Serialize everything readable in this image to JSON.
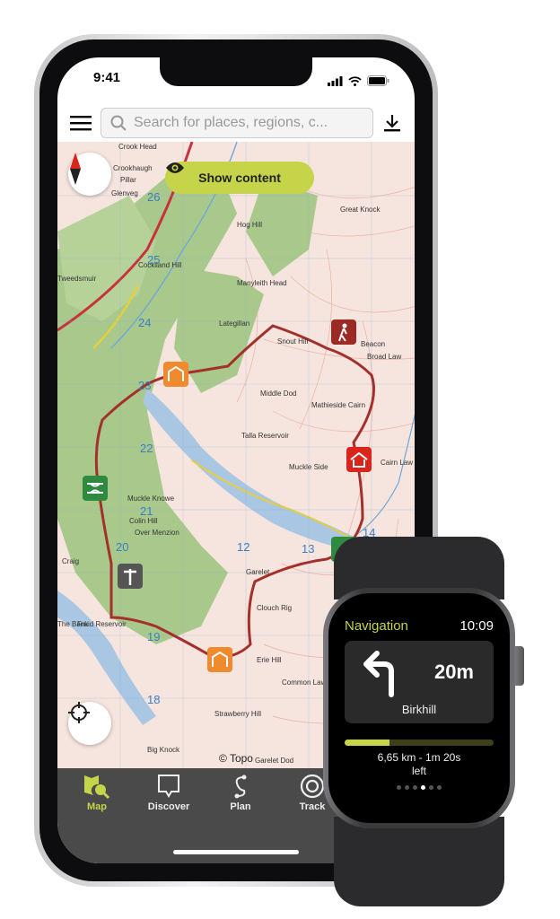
{
  "phone": {
    "status": {
      "time": "9:41"
    },
    "topbar": {
      "search_placeholder": "Search for places, regions, c...",
      "menu_icon": "hamburger-icon",
      "download_icon": "download-icon"
    },
    "map": {
      "show_content_label": "Show content",
      "copyright": "© Topo",
      "labels": [
        "Crook Head",
        "Crookhaugh",
        "Pillar",
        "Glenveg",
        "Great Knock",
        "Hog Hill",
        "Cockiland Hill",
        "Manyleith Head",
        "Lategillan",
        "Snout Hill",
        "Broad Law",
        "Beacon",
        "Middle Dod",
        "Mathieside Cairn",
        "Cairn Law",
        "Talla Reservoir",
        "Muckle Side",
        "Muckle Knowe",
        "Colin Hill",
        "Over Menzion",
        "Craig",
        "Garelet",
        "Clouch Rig",
        "Erie Hill",
        "Common Law",
        "Strawberry Hill",
        "Big Knock",
        "Garelet Dod",
        "Fruid Reservoir",
        "The Bank",
        "Tweedsmuir"
      ],
      "grid_numbers": [
        "26",
        "25",
        "24",
        "23",
        "22",
        "21",
        "20",
        "19",
        "18",
        "12",
        "13",
        "14"
      ],
      "colors": {
        "route": "#a3302b",
        "forest": "#a8c88a",
        "water": "#a9c6e3",
        "contour": "#e9a08a"
      }
    },
    "nav": {
      "items": [
        {
          "label": "Map",
          "icon": "map-search-icon",
          "active": true
        },
        {
          "label": "Discover",
          "icon": "speech-bubble-icon"
        },
        {
          "label": "Plan",
          "icon": "route-icon"
        },
        {
          "label": "Track",
          "icon": "target-icon"
        }
      ]
    }
  },
  "watch": {
    "title": "Navigation",
    "time": "10:09",
    "turn_icon": "turn-left-arrow-icon",
    "distance": "20m",
    "street": "Birkhill",
    "progress": 0.3,
    "remaining": "6,65 km - 1m 20s",
    "remaining_suffix": "left",
    "page_dots": 6,
    "active_dot": 4
  },
  "accent": "#c6d44a"
}
